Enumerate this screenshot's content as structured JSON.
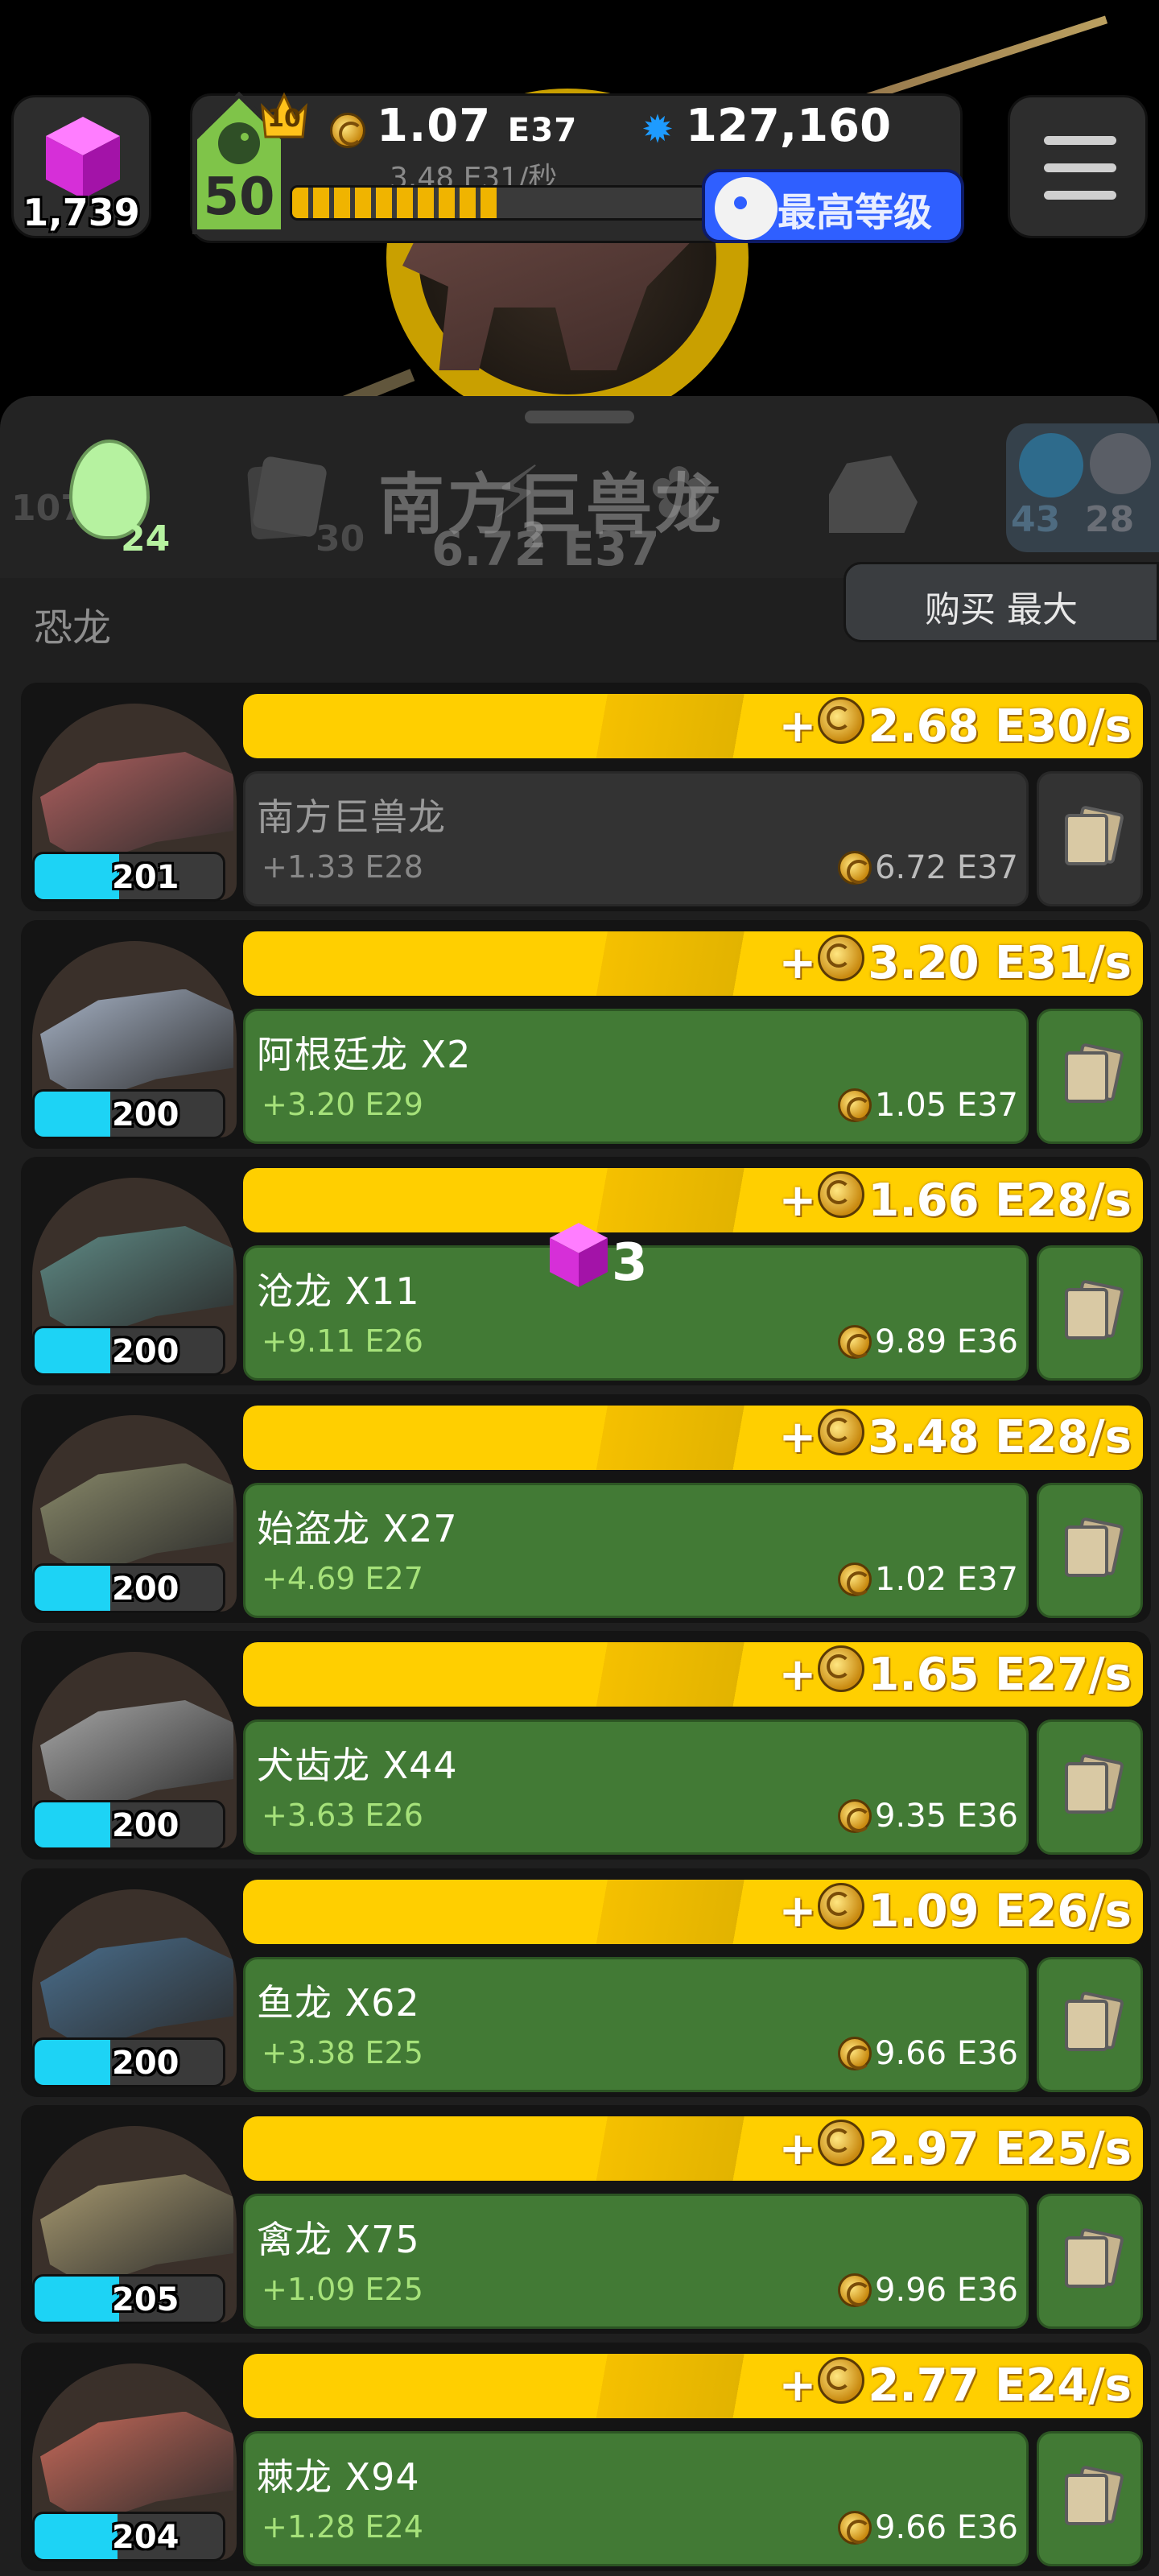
{
  "hud": {
    "gems": "1,739",
    "player_level": "50",
    "crown_level": "10",
    "coins": "1.07",
    "coins_exp": "E37",
    "rate": "3.48 E31/秒",
    "stars": "127,160",
    "max_level_label": "最高等级",
    "xp_fraction": 0.5
  },
  "tabs": {
    "eggs_bg_count": "107",
    "eggs_count": "24",
    "cards_count": "30",
    "bolt_count": "2",
    "planet_a": "43",
    "planet_b": "28",
    "overlay_title": "南方巨兽龙",
    "overlay_cost": "6.72 E37"
  },
  "section": {
    "title": "恐龙",
    "buy_max_label": "购买 最大"
  },
  "floating_gem": "3",
  "colors": {
    "accent_yellow": "#ffcf00",
    "card_green": "#427a35",
    "level_cyan": "#1dd3f5",
    "gem_magenta": "#e040fb"
  },
  "dinos": [
    {
      "name": "南方巨兽龙",
      "level": "201",
      "level_fraction": 0.45,
      "income": "+",
      "income_value": "2.68 E30/s",
      "bonus": "+1.33 E28",
      "cost": "6.72 E37",
      "locked": true,
      "icon": "giganotosaurus-head"
    },
    {
      "name": "阿根廷龙  X2",
      "level": "200",
      "level_fraction": 0.4,
      "income": "+",
      "income_value": "3.20 E31/s",
      "bonus": "+3.20 E29",
      "cost": "1.05 E37",
      "locked": false,
      "icon": "argentinosaurus-head"
    },
    {
      "name": "沧龙  X11",
      "level": "200",
      "level_fraction": 0.4,
      "income": "+",
      "income_value": "1.66 E28/s",
      "bonus": "+9.11 E26",
      "cost": "9.89 E36",
      "locked": false,
      "icon": "mosasaurus-head"
    },
    {
      "name": "始盗龙  X27",
      "level": "200",
      "level_fraction": 0.4,
      "income": "+",
      "income_value": "3.48 E28/s",
      "bonus": "+4.69 E27",
      "cost": "1.02 E37",
      "locked": false,
      "icon": "eoraptor-head"
    },
    {
      "name": "犬齿龙  X44",
      "level": "200",
      "level_fraction": 0.4,
      "income": "+",
      "income_value": "1.65 E27/s",
      "bonus": "+3.63 E26",
      "cost": "9.35 E36",
      "locked": false,
      "icon": "cynodont-head"
    },
    {
      "name": "鱼龙  X62",
      "level": "200",
      "level_fraction": 0.4,
      "income": "+",
      "income_value": "1.09 E26/s",
      "bonus": "+3.38 E25",
      "cost": "9.66 E36",
      "locked": false,
      "icon": "ichthyosaur-head"
    },
    {
      "name": "禽龙  X75",
      "level": "205",
      "level_fraction": 0.45,
      "income": "+",
      "income_value": "2.97 E25/s",
      "bonus": "+1.09 E25",
      "cost": "9.96 E36",
      "locked": false,
      "icon": "iguanodon-head"
    },
    {
      "name": "棘龙  X94",
      "level": "204",
      "level_fraction": 0.44,
      "income": "+",
      "income_value": "2.77 E24/s",
      "bonus": "+1.28 E24",
      "cost": "9.66 E36",
      "locked": false,
      "icon": "spinosaurus-head"
    }
  ]
}
